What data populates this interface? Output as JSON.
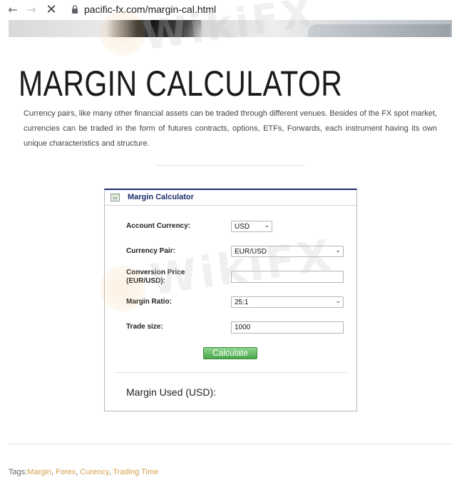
{
  "browser": {
    "url": "pacific-fx.com/margin-cal.html",
    "back_icon": "←",
    "forward_icon": "→",
    "stop_icon": "✕"
  },
  "page": {
    "title": "MARGIN CALCULATOR",
    "intro": "Currency pairs, like many other financial assets can be traded through different venues. Besides of the FX spot market, currencies can be traded in the form of futures contracts, options, ETFs, Forwards, each instrument having its own unique characteristics and structure."
  },
  "calculator": {
    "title": "Margin Calculator",
    "account_currency_label": "Account Currency:",
    "account_currency_value": "USD",
    "currency_pair_label": "Currency Pair:",
    "currency_pair_value": "EUR/USD",
    "conversion_price_label": "Conversion Price (EUR/USD):",
    "conversion_price_value": "",
    "margin_ratio_label": "Margin Ratio:",
    "margin_ratio_value": "25:1",
    "trade_size_label": "Trade size:",
    "trade_size_value": "1000",
    "calculate_label": "Calculate",
    "margin_used_label": "Margin Used (USD):",
    "chevron": "⌄"
  },
  "tags": {
    "prefix": "Tags:",
    "items": [
      "Margin",
      "Forex",
      "Curency",
      "Trading Time"
    ],
    "separator": ", "
  },
  "watermark": {
    "text": "WikiFX"
  },
  "colors": {
    "accent": "#1d2b6b",
    "button": "#4aa64a",
    "tag_link": "#d4a04a"
  }
}
